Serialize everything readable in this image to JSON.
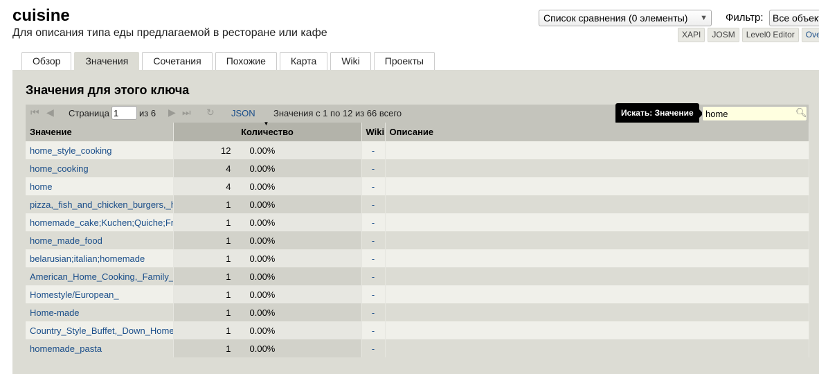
{
  "header": {
    "key": "cuisine",
    "description": "Для описания типа еды предлагаемой в ресторане или кафе",
    "compare": "Список сравнения (0 элементы)",
    "filter_label": "Фильтр:",
    "filter_value": "Все объекты",
    "editors": [
      "XAPI",
      "JOSM",
      "Level0 Editor",
      "Overpass"
    ]
  },
  "tabs": [
    {
      "label": "Обзор",
      "active": false
    },
    {
      "label": "Значения",
      "active": true
    },
    {
      "label": "Сочетания",
      "active": false
    },
    {
      "label": "Похожие",
      "active": false
    },
    {
      "label": "Карта",
      "active": false
    },
    {
      "label": "Wiki",
      "active": false
    },
    {
      "label": "Проекты",
      "active": false
    }
  ],
  "panel": {
    "title": "Значения для этого ключа",
    "pager": {
      "page_label": "Страница",
      "page_value": "1",
      "of_label": "из 6",
      "json_label": "JSON",
      "range_text": "Значения с 1 по 12 из 66 всего",
      "search_tip": "Искать: Значение",
      "search_value": "home"
    },
    "columns": [
      "Значение",
      "Количество",
      "Wiki",
      "Описание"
    ],
    "rows": [
      {
        "value": "home_style_cooking",
        "count": "12",
        "percent": "0.00%",
        "wiki": "-",
        "description": ""
      },
      {
        "value": "home_cooking",
        "count": "4",
        "percent": "0.00%",
        "wiki": "-",
        "description": ""
      },
      {
        "value": "home",
        "count": "4",
        "percent": "0.00%",
        "wiki": "-",
        "description": ""
      },
      {
        "value": "pizza,_fish_and_chicken_burgers,_h",
        "count": "1",
        "percent": "0.00%",
        "wiki": "-",
        "description": ""
      },
      {
        "value": "homemade_cake;Kuchen;Quiche;Fr",
        "count": "1",
        "percent": "0.00%",
        "wiki": "-",
        "description": ""
      },
      {
        "value": "home_made_food",
        "count": "1",
        "percent": "0.00%",
        "wiki": "-",
        "description": ""
      },
      {
        "value": "belarusian;italian;homemade",
        "count": "1",
        "percent": "0.00%",
        "wiki": "-",
        "description": ""
      },
      {
        "value": "American_Home_Cooking,_Family_",
        "count": "1",
        "percent": "0.00%",
        "wiki": "-",
        "description": ""
      },
      {
        "value": "Homestyle/European_",
        "count": "1",
        "percent": "0.00%",
        "wiki": "-",
        "description": ""
      },
      {
        "value": "Home-made",
        "count": "1",
        "percent": "0.00%",
        "wiki": "-",
        "description": ""
      },
      {
        "value": "Country_Style_Buffet,_Down_Home",
        "count": "1",
        "percent": "0.00%",
        "wiki": "-",
        "description": ""
      },
      {
        "value": "homemade_pasta",
        "count": "1",
        "percent": "0.00%",
        "wiki": "-",
        "description": ""
      }
    ]
  }
}
